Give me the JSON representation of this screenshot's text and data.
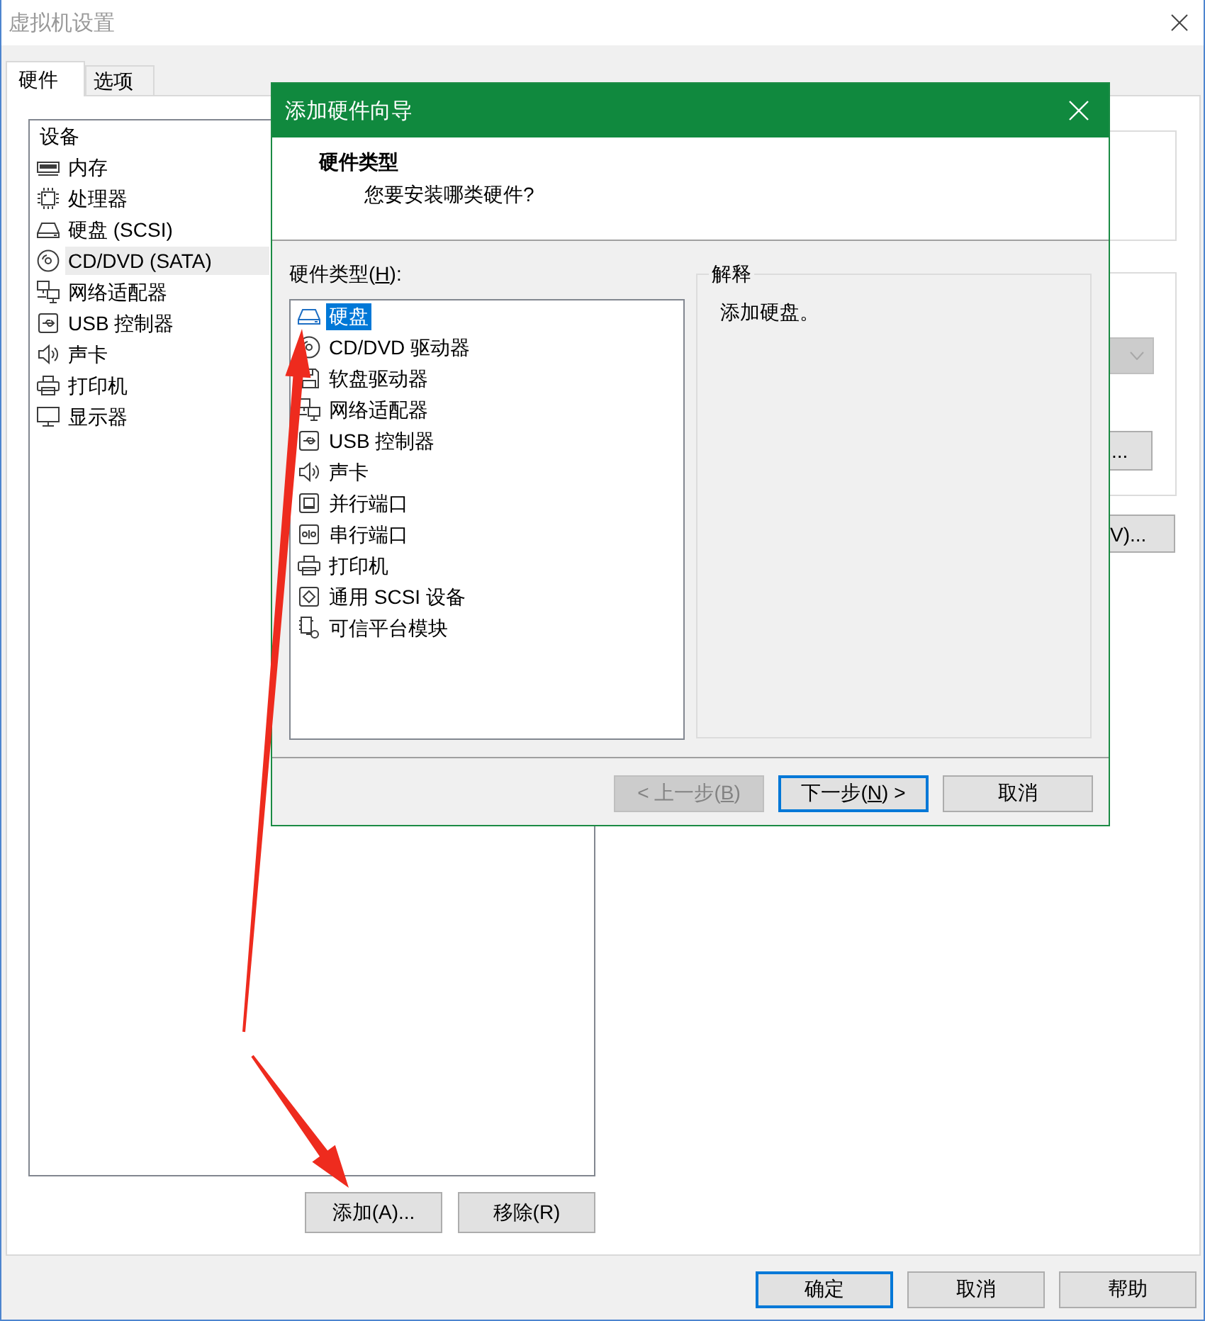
{
  "window": {
    "title": "虚拟机设置"
  },
  "tabs": [
    {
      "label": "硬件",
      "selected": true
    },
    {
      "label": "选项",
      "selected": false
    }
  ],
  "device_list": {
    "header": "设备",
    "items": [
      {
        "kind": "memory",
        "label": "内存",
        "selected": false
      },
      {
        "kind": "cpu",
        "label": "处理器",
        "selected": false
      },
      {
        "kind": "disk",
        "label": "硬盘 (SCSI)",
        "selected": false
      },
      {
        "kind": "cdrom",
        "label": "CD/DVD (SATA)",
        "selected": true
      },
      {
        "kind": "network",
        "label": "网络适配器",
        "selected": false
      },
      {
        "kind": "usb",
        "label": "USB 控制器",
        "selected": false
      },
      {
        "kind": "sound",
        "label": "声卡",
        "selected": false
      },
      {
        "kind": "printer",
        "label": "打印机",
        "selected": false
      },
      {
        "kind": "display",
        "label": "显示器",
        "selected": false
      }
    ]
  },
  "device_buttons": [
    "添加(A)...",
    "移除(R)"
  ],
  "settings_panel": {
    "dropdown": {
      "disabled": true
    },
    "buttons": [
      "...",
      "V)..."
    ]
  },
  "footer_buttons": [
    {
      "label": "确定",
      "default": true
    },
    {
      "label": "取消",
      "default": false
    },
    {
      "label": "帮助",
      "default": false
    }
  ],
  "wizard": {
    "title": "添加硬件向导",
    "heading": "硬件类型",
    "subheading": "您要安装哪类硬件?",
    "list_label": {
      "text_before": "硬件类型(",
      "access_key": "H",
      "text_after": "):"
    },
    "hardware_types": [
      {
        "kind": "disk",
        "label": "硬盘",
        "selected": true
      },
      {
        "kind": "cdrom",
        "label": "CD/DVD 驱动器",
        "selected": false
      },
      {
        "kind": "floppy",
        "label": "软盘驱动器",
        "selected": false
      },
      {
        "kind": "network",
        "label": "网络适配器",
        "selected": false
      },
      {
        "kind": "usb",
        "label": "USB 控制器",
        "selected": false
      },
      {
        "kind": "sound",
        "label": "声卡",
        "selected": false
      },
      {
        "kind": "parallel",
        "label": "并行端口",
        "selected": false
      },
      {
        "kind": "serial",
        "label": "串行端口",
        "selected": false
      },
      {
        "kind": "printer",
        "label": "打印机",
        "selected": false
      },
      {
        "kind": "scsi",
        "label": "通用 SCSI 设备",
        "selected": false
      },
      {
        "kind": "tpm",
        "label": "可信平台模块",
        "selected": false
      }
    ],
    "explanation": {
      "title": "解释",
      "text": "添加硬盘。"
    },
    "buttons": [
      {
        "text_before": "< 上一步(",
        "access_key": "B",
        "text_after": ")",
        "disabled": true,
        "default": false
      },
      {
        "text_before": "下一步(",
        "access_key": "N",
        "text_after": ") >",
        "disabled": false,
        "default": true
      },
      {
        "label": "取消",
        "disabled": false,
        "default": false
      }
    ]
  },
  "annotations": [
    {
      "kind": "arrow"
    },
    {
      "kind": "arrow"
    }
  ]
}
